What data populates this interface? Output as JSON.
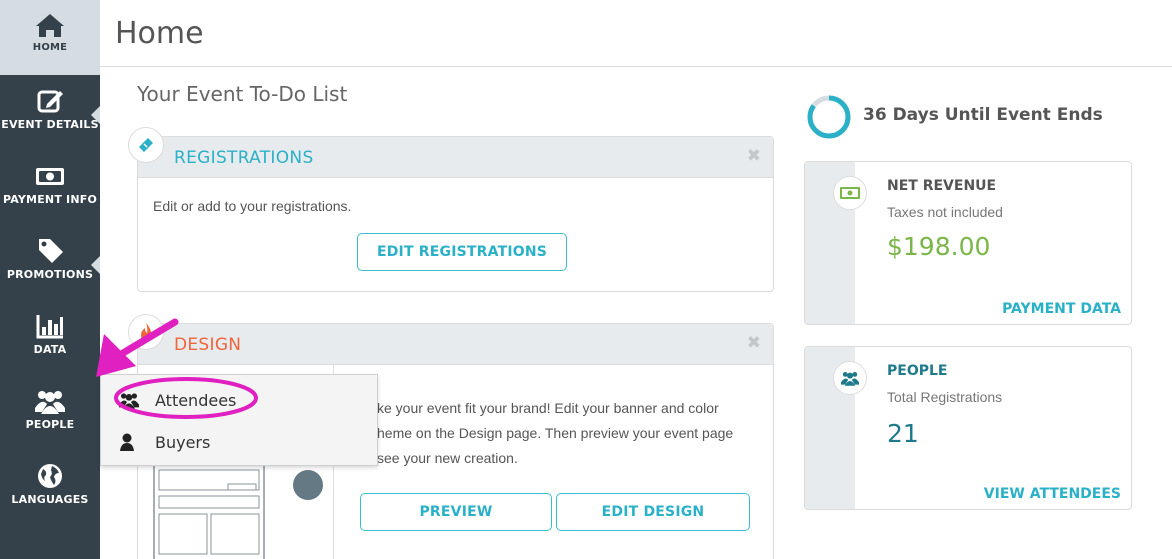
{
  "sidebar": {
    "items": [
      {
        "label": "HOME",
        "icon": "home-icon"
      },
      {
        "label": "EVENT DETAILS",
        "icon": "edit-icon"
      },
      {
        "label": "PAYMENT INFO",
        "icon": "banknote-icon"
      },
      {
        "label": "PROMOTIONS",
        "icon": "tag-icon"
      },
      {
        "label": "DATA",
        "icon": "bar-chart-icon"
      },
      {
        "label": "PEOPLE",
        "icon": "people-icon"
      },
      {
        "label": "LANGUAGES",
        "icon": "globe-icon"
      }
    ]
  },
  "header": {
    "title": "Home"
  },
  "todo": {
    "title": "Your Event To-Do List",
    "registrations": {
      "title": "REGISTRATIONS",
      "text": "Edit or add to your registrations.",
      "button": "EDIT REGISTRATIONS",
      "close": "✖"
    },
    "design": {
      "title": "DESIGN",
      "text_lines": [
        "ke your event fit your brand! Edit your banner and color",
        "heme on the Design page. Then preview your event page",
        "see your new creation."
      ],
      "preview_button": "PREVIEW",
      "edit_button": "EDIT DESIGN",
      "close": "✖"
    }
  },
  "countdown": {
    "text": "36 Days Until Event Ends",
    "fraction_remaining": 0.85
  },
  "net_revenue": {
    "title": "NET REVENUE",
    "subtitle": "Taxes not included",
    "value": "$198.00",
    "link": "PAYMENT DATA"
  },
  "people": {
    "title": "PEOPLE",
    "subtitle": "Total Registrations",
    "value": "21",
    "link": "VIEW ATTENDEES"
  },
  "dropdown": {
    "items": [
      {
        "label": "Attendees",
        "icon": "people-icon"
      },
      {
        "label": "Buyers",
        "icon": "person-icon"
      }
    ]
  },
  "colors": {
    "sidebar": "#34414a",
    "accent": "#2ab1c8",
    "design_orange": "#f0643a",
    "revenue_green": "#7ab648",
    "people_teal": "#1f7a8c",
    "annotation_magenta": "#e020c0"
  }
}
